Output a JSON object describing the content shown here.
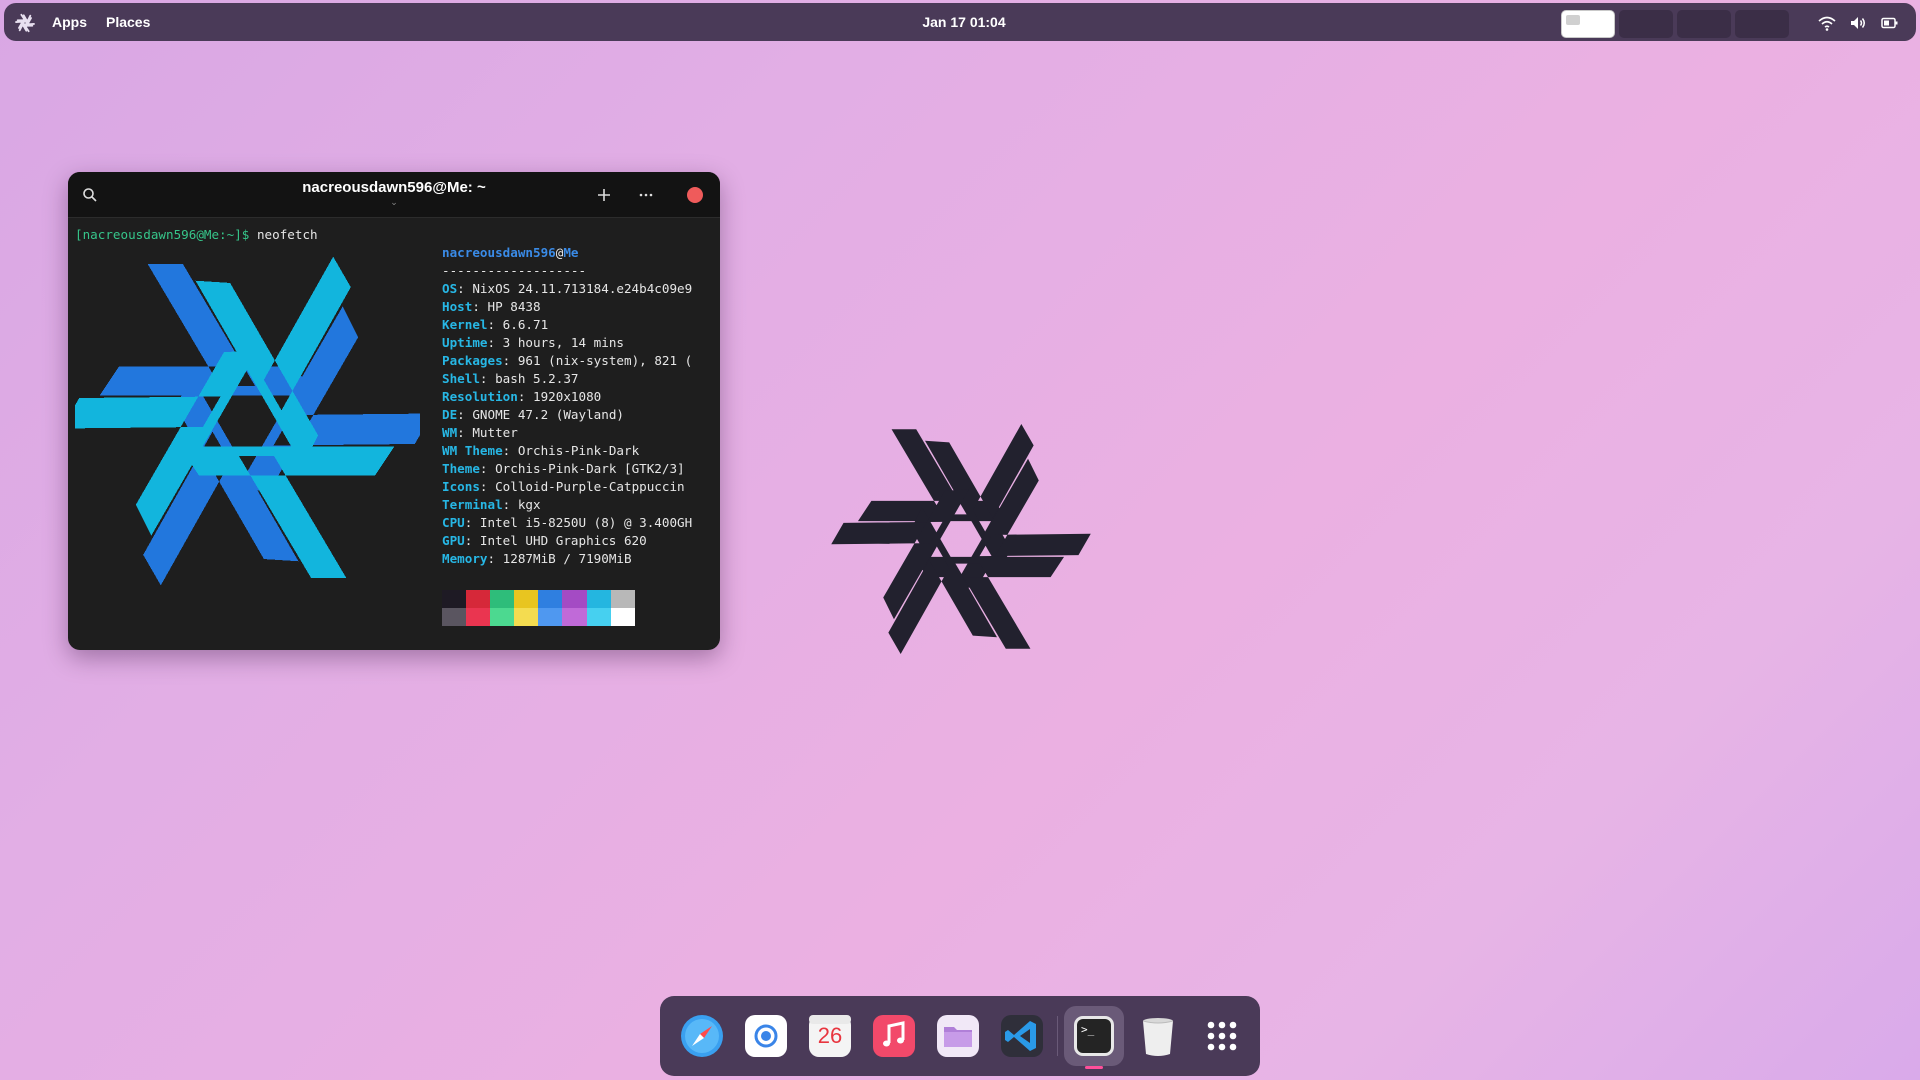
{
  "topbar": {
    "apps_label": "Apps",
    "places_label": "Places",
    "datetime": "Jan 17  01:04",
    "workspaces": [
      "workspace-1",
      "workspace-2",
      "workspace-3",
      "workspace-4"
    ],
    "active_workspace": 1,
    "tray_icons": [
      "wifi-icon",
      "volume-icon",
      "battery-icon"
    ]
  },
  "terminal": {
    "title": "nacreousdawn596@Me: ~",
    "subtitle": "⌄",
    "prompt": "[nacreousdawn596@Me:~]$",
    "command": " neofetch",
    "user": "nacreousdawn596",
    "at": "@",
    "host": "Me",
    "separator": "-------------------",
    "info": [
      {
        "key": "OS",
        "value": ": NixOS 24.11.713184.e24b4c09e9"
      },
      {
        "key": "Host",
        "value": ": HP 8438"
      },
      {
        "key": "Kernel",
        "value": ": 6.6.71"
      },
      {
        "key": "Uptime",
        "value": ": 3 hours, 14 mins"
      },
      {
        "key": "Packages",
        "value": ": 961 (nix-system), 821 ("
      },
      {
        "key": "Shell",
        "value": ": bash 5.2.37"
      },
      {
        "key": "Resolution",
        "value": ": 1920x1080"
      },
      {
        "key": "DE",
        "value": ": GNOME 47.2 (Wayland)"
      },
      {
        "key": "WM",
        "value": ": Mutter"
      },
      {
        "key": "WM Theme",
        "value": ": Orchis-Pink-Dark"
      },
      {
        "key": "Theme",
        "value": ": Orchis-Pink-Dark [GTK2/3]"
      },
      {
        "key": "Icons",
        "value": ": Colloid-Purple-Catppuccin"
      },
      {
        "key": "Terminal",
        "value": ": kgx"
      },
      {
        "key": "CPU",
        "value": ": Intel i5-8250U (8) @ 3.400GH"
      },
      {
        "key": "GPU",
        "value": ": Intel UHD Graphics 620"
      },
      {
        "key": "Memory",
        "value": ": 1287MiB / 7190MiB"
      }
    ],
    "palette_top": [
      "#1e1a24",
      "#d62839",
      "#2ebd7a",
      "#e8c520",
      "#2f7fe0",
      "#a44bc4",
      "#24b6e0",
      "#b8b8b8"
    ],
    "palette_bottom": [
      "#5a5560",
      "#ea3550",
      "#4cd990",
      "#f4dc50",
      "#4f98f0",
      "#c06ad8",
      "#46d0f0",
      "#ffffff"
    ],
    "logo_colors": {
      "dark": "#2277dd",
      "light": "#12b5dd"
    }
  },
  "desktop": {
    "logo_color": "#22212e"
  },
  "dock": {
    "apps": [
      "safari",
      "chromium",
      "calendar",
      "music",
      "files",
      "vscode",
      "terminal",
      "trash",
      "app-grid"
    ],
    "calendar_day": "26",
    "terminal_glyph": ">_"
  }
}
